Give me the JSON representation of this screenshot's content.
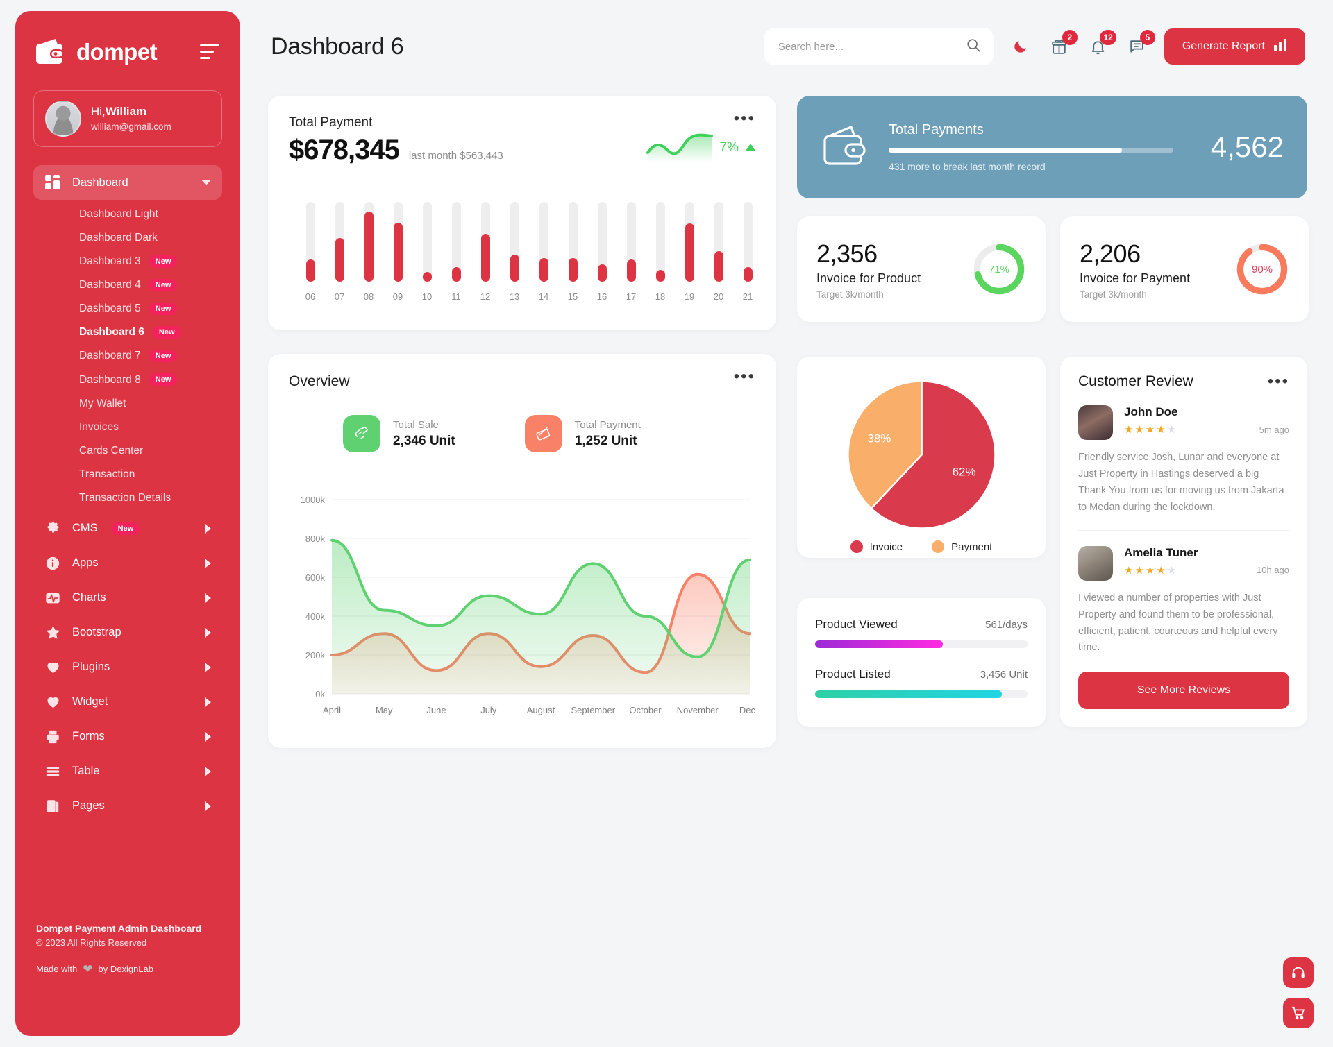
{
  "sidebar": {
    "brand": "dompet",
    "brand_logo_icon": "wallet-icon",
    "menu_toggle_icon": "hamburger-icon",
    "profile": {
      "greeting_prefix": "Hi,",
      "name": "William",
      "email": "william@gmail.com"
    },
    "dashboard_group": {
      "label": "Dashboard",
      "icon": "grid-icon",
      "expanded": true,
      "children": [
        {
          "label": "Dashboard Light",
          "badge": "",
          "current": false
        },
        {
          "label": "Dashboard Dark",
          "badge": "",
          "current": false
        },
        {
          "label": "Dashboard 3",
          "badge": "New",
          "current": false
        },
        {
          "label": "Dashboard 4",
          "badge": "New",
          "current": false
        },
        {
          "label": "Dashboard 5",
          "badge": "New",
          "current": false
        },
        {
          "label": "Dashboard 6",
          "badge": "New",
          "current": true
        },
        {
          "label": "Dashboard 7",
          "badge": "New",
          "current": false
        },
        {
          "label": "Dashboard 8",
          "badge": "New",
          "current": false
        },
        {
          "label": "My Wallet",
          "badge": "",
          "current": false
        },
        {
          "label": "Invoices",
          "badge": "",
          "current": false
        },
        {
          "label": "Cards Center",
          "badge": "",
          "current": false
        },
        {
          "label": "Transaction",
          "badge": "",
          "current": false
        },
        {
          "label": "Transaction Details",
          "badge": "",
          "current": false
        }
      ]
    },
    "items": [
      {
        "label": "CMS",
        "icon": "gear-icon",
        "badge": "New"
      },
      {
        "label": "Apps",
        "icon": "info-icon",
        "badge": ""
      },
      {
        "label": "Charts",
        "icon": "pulse-icon",
        "badge": ""
      },
      {
        "label": "Bootstrap",
        "icon": "star-icon",
        "badge": ""
      },
      {
        "label": "Plugins",
        "icon": "heart-icon",
        "badge": ""
      },
      {
        "label": "Widget",
        "icon": "heart-icon",
        "badge": ""
      },
      {
        "label": "Forms",
        "icon": "printer-icon",
        "badge": ""
      },
      {
        "label": "Table",
        "icon": "table-icon",
        "badge": ""
      },
      {
        "label": "Pages",
        "icon": "pages-icon",
        "badge": ""
      }
    ],
    "footer": {
      "title": "Dompet Payment Admin Dashboard",
      "copyright": "© 2023 All Rights Reserved",
      "made_with_prefix": "Made with",
      "made_with_suffix": "by DexignLab",
      "heart_icon": "heart-icon"
    }
  },
  "header": {
    "page_title": "Dashboard 6",
    "search": {
      "placeholder": "Search here...",
      "value": "",
      "icon": "search-icon"
    },
    "dark_mode_icon": "moon-icon",
    "notifications": [
      {
        "icon": "gift-icon",
        "count": "2"
      },
      {
        "icon": "bell-icon",
        "count": "12"
      },
      {
        "icon": "message-icon",
        "count": "5"
      }
    ],
    "generate_report": {
      "label": "Generate Report",
      "icon": "bar-chart-icon"
    }
  },
  "total_payment": {
    "title": "Total Payment",
    "amount": "$678,345",
    "last_month": "last month $563,443",
    "percent": "7%",
    "trend_icon": "arrow-up-icon",
    "menu_icon": "more-dots-icon"
  },
  "total_payments_banner": {
    "icon": "wallet-icon",
    "title": "Total Payments",
    "progress_percent": 82,
    "subtitle": "431 more to break last month record",
    "value": "4,562"
  },
  "stat_cards": [
    {
      "value": "2,356",
      "label": "Invoice for Product",
      "target": "Target 3k/month",
      "percent": "71%",
      "percent_num": 71,
      "color": "#5ad65f"
    },
    {
      "value": "2,206",
      "label": "Invoice for Payment",
      "target": "Target 3k/month",
      "percent": "90%",
      "percent_num": 90,
      "color": "#fa7a5e"
    }
  ],
  "overview": {
    "title": "Overview",
    "menu_icon": "more-dots-icon",
    "stats": [
      {
        "icon": "sale-hand-icon",
        "label": "Total Sale",
        "value": "2,346 Unit",
        "color": "#5fd171"
      },
      {
        "icon": "card-swipe-icon",
        "label": "Total Payment",
        "value": "1,252 Unit",
        "color": "#f98168"
      }
    ]
  },
  "pie": {
    "menu_icon": ""
  },
  "progress_card": {
    "rows": [
      {
        "label": "Product Viewed",
        "value": "561/days",
        "percent": 60,
        "from": "#9c2bd6",
        "to": "#ff2ae0"
      },
      {
        "label": "Product Listed",
        "value": "3,456 Unit",
        "percent": 88,
        "from": "#2fd0a5",
        "to": "#21d4e3"
      }
    ]
  },
  "reviews": {
    "title": "Customer Review",
    "menu_icon": "more-dots-icon",
    "items": [
      {
        "name": "John Doe",
        "stars": 4,
        "time": "5m ago",
        "text": "Friendly service Josh, Lunar and everyone at Just Property in Hastings deserved a big Thank You from us for moving us from Jakarta to Medan during the lockdown."
      },
      {
        "name": "Amelia Tuner",
        "stars": 4,
        "time": "10h ago",
        "text": "I viewed a number of properties with Just Property and found them to be professional, efficient, patient, courteous and helpful every time."
      }
    ],
    "see_more_label": "See More Reviews"
  },
  "floating": {
    "support_icon": "headset-icon",
    "cart_icon": "cart-icon"
  },
  "theme": {
    "brand_red": "#dd3444",
    "banner_blue": "#6e9fb8",
    "green": "#5fd171",
    "orange": "#f9a95e",
    "pie_red": "#d93a4c"
  },
  "chart_data": [
    {
      "type": "bar",
      "title": "Total Payment",
      "categories": [
        "06",
        "07",
        "08",
        "09",
        "10",
        "11",
        "12",
        "13",
        "14",
        "15",
        "16",
        "17",
        "18",
        "19",
        "20",
        "21"
      ],
      "values": [
        28,
        55,
        88,
        74,
        12,
        18,
        60,
        34,
        30,
        30,
        22,
        28,
        15,
        73,
        38,
        18
      ],
      "track_max": 100,
      "xlabel": "",
      "ylabel": "",
      "ylim": [
        0,
        100
      ],
      "grid": false
    },
    {
      "type": "area",
      "title": "Overview",
      "x": [
        "April",
        "May",
        "June",
        "July",
        "August",
        "September",
        "October",
        "November",
        "Dec.."
      ],
      "series": [
        {
          "name": "Total Sale",
          "color": "#5fd171",
          "values": [
            790,
            430,
            350,
            505,
            410,
            670,
            400,
            190,
            690
          ]
        },
        {
          "name": "Total Payment",
          "color": "#f98168",
          "values": [
            200,
            310,
            120,
            310,
            140,
            300,
            110,
            615,
            310
          ]
        }
      ],
      "ylabel": "",
      "xlabel": "",
      "yticks": [
        "0k",
        "200k",
        "400k",
        "600k",
        "800k",
        "1000k"
      ],
      "ylim": [
        0,
        1000
      ],
      "grid": true,
      "legend": false
    },
    {
      "type": "pie",
      "labels": [
        "Invoice",
        "Payment"
      ],
      "values": [
        62,
        38
      ],
      "data_labels": [
        "62%",
        "38%"
      ],
      "colors": [
        "#d93a4c",
        "#f9ae6a"
      ],
      "legend": "bottom"
    }
  ]
}
